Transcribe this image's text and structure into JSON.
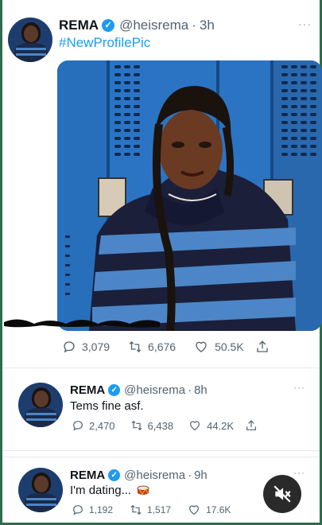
{
  "tweets": [
    {
      "name": "REMA",
      "handle": "@heisrema",
      "dot": "·",
      "time": "3h",
      "text": "#NewProfilePic",
      "reply_count": "3,079",
      "retweet_count": "6,676",
      "like_count": "50.5K",
      "more": "···"
    },
    {
      "name": "REMA",
      "handle": "@heisrema",
      "dot": "·",
      "time": "8h",
      "text": "Tems fine asf.",
      "reply_count": "2,470",
      "retweet_count": "6,438",
      "like_count": "44.2K",
      "more": "···"
    },
    {
      "name": "REMA",
      "handle": "@heisrema",
      "dot": "·",
      "time": "9h",
      "text": "I'm dating...",
      "reply_count": "1,192",
      "retweet_count": "1,517",
      "like_count": "17.6K",
      "more": "···"
    }
  ],
  "icons": {
    "verified": "verified-badge-icon",
    "reply": "reply-icon",
    "retweet": "retweet-icon",
    "like": "heart-icon",
    "share": "share-icon",
    "mute": "speaker-muted-icon",
    "drum": "drum-emoji-icon"
  },
  "colors": {
    "hashtag": "#1d9bf0",
    "verified": "#1d9bf0",
    "meta": "#536471",
    "frame": "#2e6b4f"
  }
}
